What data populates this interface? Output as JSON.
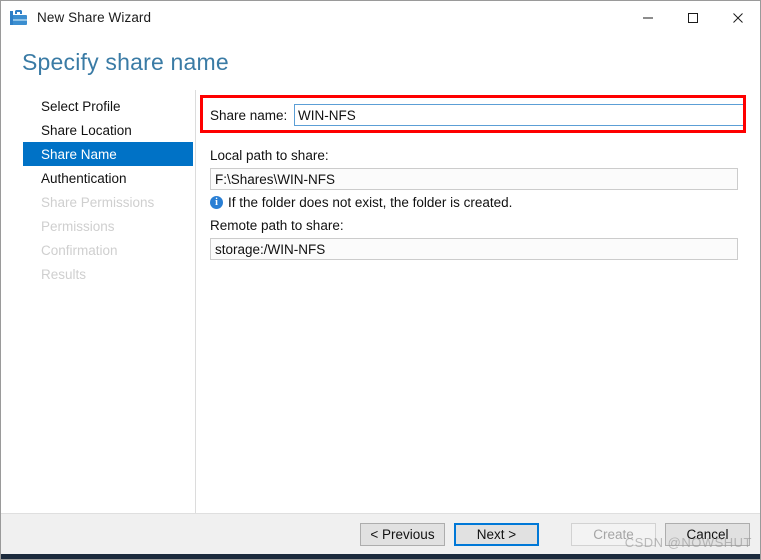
{
  "window": {
    "title": "New Share Wizard",
    "app_icon": "share-wizard-icon",
    "controls": {
      "minimize": "minimize-icon",
      "maximize": "maximize-icon",
      "close": "close-icon"
    }
  },
  "header": {
    "title": "Specify share name",
    "title_color": "#3a7ba5"
  },
  "sidebar": {
    "items": [
      {
        "label": "Select Profile",
        "state": "done"
      },
      {
        "label": "Share Location",
        "state": "done"
      },
      {
        "label": "Share Name",
        "state": "current"
      },
      {
        "label": "Authentication",
        "state": "done"
      },
      {
        "label": "Share Permissions",
        "state": "disabled"
      },
      {
        "label": "Permissions",
        "state": "disabled"
      },
      {
        "label": "Confirmation",
        "state": "disabled"
      },
      {
        "label": "Results",
        "state": "disabled"
      }
    ],
    "highlight_color": "#0072c6"
  },
  "main": {
    "share_name": {
      "label": "Share name:",
      "value": "WIN-NFS",
      "placeholder": ""
    },
    "local_path": {
      "label": "Local path to share:",
      "value": "F:\\Shares\\WIN-NFS",
      "hint_icon": "info-icon",
      "hint": "If the folder does not exist, the folder is created."
    },
    "remote_path": {
      "label": "Remote path to share:",
      "value": "storage:/WIN-NFS"
    },
    "annotation": {
      "color": "#fe0000"
    }
  },
  "footer": {
    "buttons": [
      {
        "label": "< Previous",
        "state": "normal"
      },
      {
        "label": "Next >",
        "state": "focused"
      },
      {
        "label": "Create",
        "state": "disabled"
      },
      {
        "label": "Cancel",
        "state": "normal"
      }
    ]
  },
  "watermark": {
    "text": "CSDN @NOWSHUT"
  }
}
